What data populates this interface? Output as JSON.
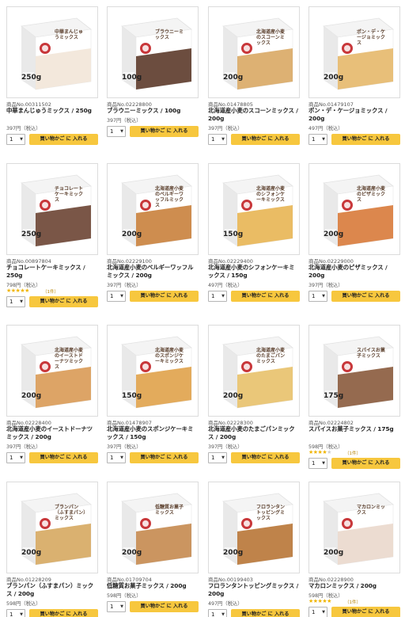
{
  "cart_label": "買い物かご に 入れる",
  "qty_default": "1",
  "products": [
    {
      "no": "商品No.00311502",
      "name": "中華まんじゅうミックス / 250g",
      "price": "397円（税込）",
      "box_title": "中華まんじゅうミックス",
      "box_weight": "250g",
      "color": "#f2e6d8"
    },
    {
      "no": "商品No.02228800",
      "name": "ブラウニーミックス / 100g",
      "price": "397円（税込）",
      "box_title": "ブラウニーミックス",
      "box_weight": "100g",
      "color": "#5c3a2a"
    },
    {
      "no": "商品No.01478805",
      "name": "北海道産小麦のスコーンミックス / 200g",
      "price": "397円（税込）",
      "box_title": "北海道産小麦のスコーンミックス",
      "box_weight": "200g",
      "color": "#d9a964"
    },
    {
      "no": "商品No.01479107",
      "name": "ポン・デ・ケージョミックス / 200g",
      "price": "497円（税込）",
      "box_title": "ポン・デ・ケージョミックス",
      "box_weight": "200g",
      "color": "#e6b86a"
    },
    {
      "no": "商品No.00897804",
      "name": "チョコレートケーキミックス / 250g",
      "price": "798円（税込）",
      "rating": 5,
      "reviews": "（1件）",
      "box_title": "チョコレートケーキミックス",
      "box_weight": "250g",
      "color": "#6b4433"
    },
    {
      "no": "商品No.02229100",
      "name": "北海道産小麦のベルギーワッフルミックス / 200g",
      "price": "397円（税込）",
      "box_title": "北海道産小麦のベルギーワッフルミックス",
      "box_weight": "200g",
      "color": "#c9813c"
    },
    {
      "no": "商品No.02229400",
      "name": "北海道産小麦のシフォンケーキミックス / 150g",
      "price": "497円（税込）",
      "box_title": "北海道産小麦のシフォンケーキミックス",
      "box_weight": "150g",
      "color": "#e8b553"
    },
    {
      "no": "商品No.02229000",
      "name": "北海道産小麦のピザミックス / 200g",
      "price": "397円（税込）",
      "box_title": "北海道産小麦のピザミックス",
      "box_weight": "200g",
      "color": "#d87a3a"
    },
    {
      "no": "商品No.02228400",
      "name": "北海道産小麦のイーストドーナツミックス / 200g",
      "price": "397円（税込）",
      "box_title": "北海道産小麦のイーストドーナツミックス",
      "box_weight": "200g",
      "color": "#d99a55"
    },
    {
      "no": "商品No.01478907",
      "name": "北海道産小麦のスポンジケーキミックス / 150g",
      "price": "397円（税込）",
      "box_title": "北海道産小麦のスポンジケーキミックス",
      "box_weight": "150g",
      "color": "#e0a24a"
    },
    {
      "no": "商品No.02228300",
      "name": "北海道産小麦のたまごパンミックス / 200g",
      "price": "397円（税込）",
      "box_title": "北海道産小麦のたまごパンミックス",
      "box_weight": "200g",
      "color": "#e8c16a"
    },
    {
      "no": "商品No.02224802",
      "name": "スパイスお菓子ミックス / 175g",
      "price": "598円（税込）",
      "rating": 4,
      "reviews": "（1件）",
      "box_title": "スパイスお菓子ミックス",
      "box_weight": "175g",
      "color": "#8a5a3c"
    },
    {
      "no": "商品No.01228209",
      "name": "ブランパン（ふすまパン）ミックス / 200g",
      "price": "598円（税込）",
      "box_title": "ブランパン（ふすまパン）ミックス",
      "box_weight": "200g",
      "color": "#d6a861"
    },
    {
      "no": "商品No.01709704",
      "name": "低糖質お菓子ミックス / 200g",
      "price": "598円（税込）",
      "box_title": "低糖質お菓子ミックス",
      "box_weight": "200g",
      "color": "#c58a4f"
    },
    {
      "no": "商品No.00199403",
      "name": "フロランタントッピングミックス / 200g",
      "price": "497円（税込）",
      "box_title": "フロランタントッピングミックス",
      "box_weight": "200g",
      "color": "#b87636"
    },
    {
      "no": "商品No.02228900",
      "name": "マカロンミックス / 200g",
      "price": "598円（税込）",
      "rating": 5,
      "reviews": "（1件）",
      "box_title": "マカロンミックス",
      "box_weight": "200g",
      "color": "#ead8cc"
    }
  ]
}
